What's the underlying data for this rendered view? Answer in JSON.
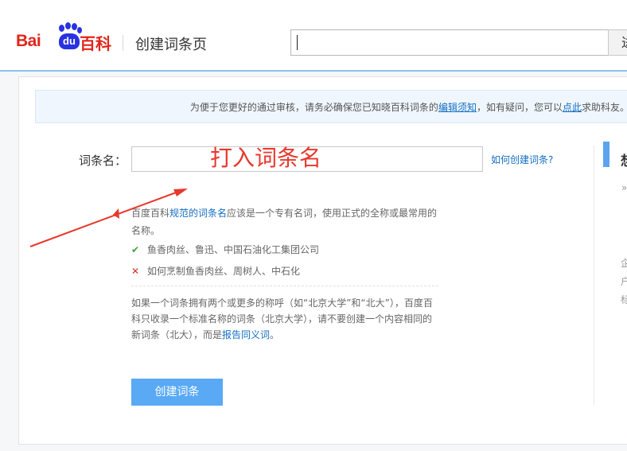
{
  "header": {
    "logo_text_bai": "Bai",
    "logo_text_du": "du",
    "logo_text_baike": "百科",
    "page_title": "创建词条页",
    "search": {
      "value": "",
      "placeholder": ""
    },
    "search_button_label": "进入词条"
  },
  "notice": {
    "text_before": "为便于您更好的通过审核，请务必确保您已知晓百科词条的",
    "link_guide": "编辑须知",
    "text_middle": "，如有疑问，您可以",
    "link_click": "点此",
    "text_after": "求助科友。"
  },
  "form": {
    "entry_label": "词条名：",
    "entry_input": {
      "value": "",
      "placeholder": ""
    },
    "help_link": "如何创建词条?",
    "annotation": "打入词条名"
  },
  "tips": {
    "line1_pre": "百度百科",
    "line1_link": "规范的词条名",
    "line1_post": "应该是一个专有名词，使用正式的全称或最常用的",
    "line2": "名称。",
    "good_example": "鱼香肉丝、鲁迅、中国石油化工集团公司",
    "bad_example": "如何烹制鱼香肉丝、周树人、中石化",
    "para_line1": "如果一个词条拥有两个或更多的称呼（如“北京大学”和“北大”），百度百",
    "para_line2": "科只收录一个标准名称的词条（北京大学），请不要创建一个内容相同的",
    "para_line3_pre": "新词条（北大），而是",
    "para_line3_link": "报告同义词",
    "para_line3_post": "。"
  },
  "create_button_label": "创建词条",
  "side_panel": {
    "fragment_title": "想",
    "fragment_1": "»",
    "fragment_2": "企",
    "fragment_3": "户",
    "fragment_4": "标"
  },
  "colors": {
    "brand_red": "#e1251b",
    "brand_blue": "#2932e1",
    "link_blue": "#136ec2",
    "button_blue": "#59a9f5",
    "annotation_red": "#e8372c"
  },
  "icons": [
    "baidu-paw-icon",
    "check-icon",
    "cross-icon",
    "arrow-annotation-icon"
  ]
}
